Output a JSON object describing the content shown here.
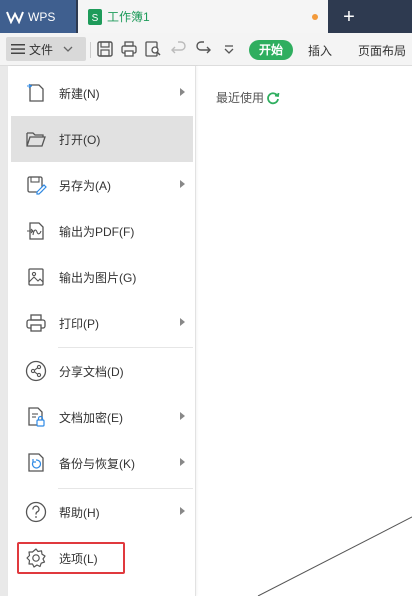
{
  "tabs": {
    "app_label": "WPS",
    "doc_title": "工作簿1",
    "add_label": "+"
  },
  "toolbar": {
    "file_label": "文件",
    "start_label": "开始",
    "insert_label": "插入",
    "layout_label": "页面布局"
  },
  "menu": {
    "items": [
      {
        "label": "新建(N)",
        "icon": "new-file-icon",
        "has_submenu": true
      },
      {
        "label": "打开(O)",
        "icon": "folder-open-icon",
        "has_submenu": false,
        "active": true
      },
      {
        "label": "另存为(A)",
        "icon": "save-as-icon",
        "has_submenu": true
      },
      {
        "label": "输出为PDF(F)",
        "icon": "pdf-export-icon",
        "has_submenu": false
      },
      {
        "label": "输出为图片(G)",
        "icon": "image-export-icon",
        "has_submenu": false
      },
      {
        "label": "打印(P)",
        "icon": "printer-icon",
        "has_submenu": true
      },
      {
        "label": "分享文档(D)",
        "icon": "share-icon",
        "has_submenu": false
      },
      {
        "label": "文档加密(E)",
        "icon": "encrypt-icon",
        "has_submenu": true
      },
      {
        "label": "备份与恢复(K)",
        "icon": "backup-icon",
        "has_submenu": true
      },
      {
        "label": "帮助(H)",
        "icon": "help-icon",
        "has_submenu": true
      },
      {
        "label": "选项(L)",
        "icon": "gear-icon",
        "has_submenu": false,
        "highlighted": true
      }
    ]
  },
  "recent": {
    "label": "最近使用"
  },
  "colors": {
    "accent_green": "#2fae5f",
    "highlight_red": "#e0393e",
    "tab_bar": "#2e3a50"
  }
}
